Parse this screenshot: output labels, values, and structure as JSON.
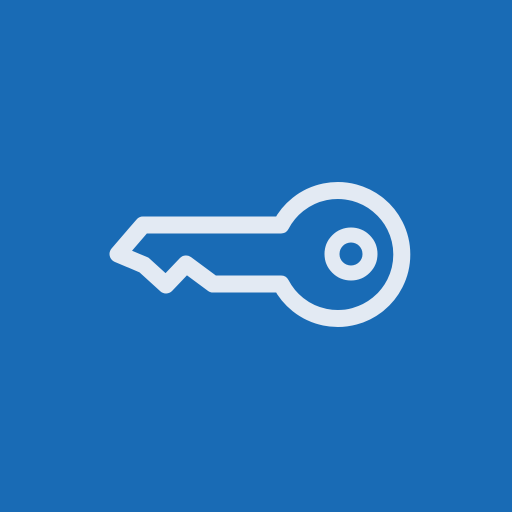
{
  "icon": {
    "name": "key-icon",
    "background_color": "#196bb5",
    "stroke_color": "#e3eaf3"
  }
}
